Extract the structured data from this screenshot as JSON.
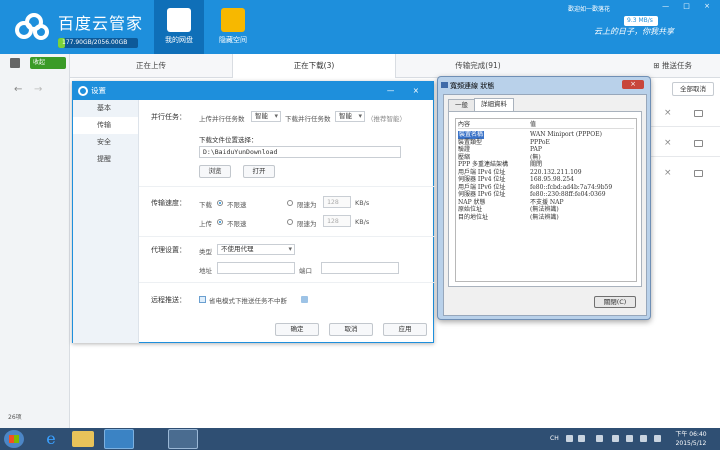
{
  "app": {
    "title": "百度云管家",
    "quota": "177.90GB/2056.00GB",
    "quota_fraction": 0.0865,
    "nav": [
      {
        "label": "我的网盘",
        "active": true
      },
      {
        "label": "隐藏空间",
        "active": false
      }
    ],
    "welcome": "歡迎如一歡落花",
    "speed": "9.3 MB/s",
    "slogan": "云上的日子，你我共享",
    "window_controls": "— □ ×"
  },
  "sidebar": {
    "collapse_label": "收起",
    "count": "26项"
  },
  "tabs": {
    "items": [
      "正在上传",
      "正在下载(3)",
      "传输完成(91)"
    ],
    "push": "推送任务",
    "cancel_all": "全部取消"
  },
  "settings": {
    "title": "设置",
    "controls": "— ×",
    "nav": [
      "基本",
      "传输",
      "安全",
      "提醒"
    ],
    "parallel": {
      "label": "并行任务：",
      "upload_label": "上传并行任务数",
      "upload_value": "智能",
      "download_label": "下载并行任务数",
      "download_value": "智能",
      "recommend": "（推荐智能）"
    },
    "download_location": {
      "label": "下载文件位置选择：",
      "path": "D:\\BaiduYunDownload",
      "browse": "浏览",
      "open": "打开"
    },
    "speed": {
      "label": "传输速度：",
      "download": "下载",
      "upload": "上传",
      "unlimited": "不限速",
      "limit": "限速为",
      "limit_value": "128",
      "unit": "KB/s"
    },
    "proxy": {
      "label": "代理设置：",
      "type_label": "类型",
      "type_value": "不使用代理",
      "address": "地址",
      "port": "端口"
    },
    "remote": {
      "label": "远程推送：",
      "option": "省电模式下推送任务不中断"
    },
    "buttons": {
      "ok": "确定",
      "cancel": "取消",
      "apply": "应用"
    }
  },
  "connection": {
    "title": "寬頻連線 狀態",
    "close": "×",
    "tabs": [
      "一般",
      "詳細資料"
    ],
    "header": {
      "k": "內容",
      "v": "值"
    },
    "rows": [
      {
        "k": "裝置名稱",
        "v": "WAN Miniport (PPPOE)",
        "selected": true
      },
      {
        "k": "裝置類型",
        "v": "PPPoE"
      },
      {
        "k": "驗證",
        "v": "PAP"
      },
      {
        "k": "壓縮",
        "v": "(無)"
      },
      {
        "k": "PPP 多重連結架構",
        "v": "關閉"
      },
      {
        "k": "用戶端 IPv4 位址",
        "v": "220.132.211.109"
      },
      {
        "k": "伺服器 IPv4 位址",
        "v": "168.95.98.254"
      },
      {
        "k": "用戶端 IPv6 位址",
        "v": "fe80::fcbd:ad4b:7a74:9b59"
      },
      {
        "k": "伺服器 IPv6 位址",
        "v": "fe80::230:88ff:fe04:0369"
      },
      {
        "k": "NAP 狀態",
        "v": "不支援 NAP"
      },
      {
        "k": "原始位址",
        "v": "(無法辨識)"
      },
      {
        "k": "目的地位址",
        "v": "(無法辨識)"
      }
    ],
    "close_button": "關閉(C)"
  },
  "taskbar": {
    "tray_text": "CH",
    "time": "下午 06:40",
    "date": "2015/5/12",
    "ie_glyph": "e"
  }
}
